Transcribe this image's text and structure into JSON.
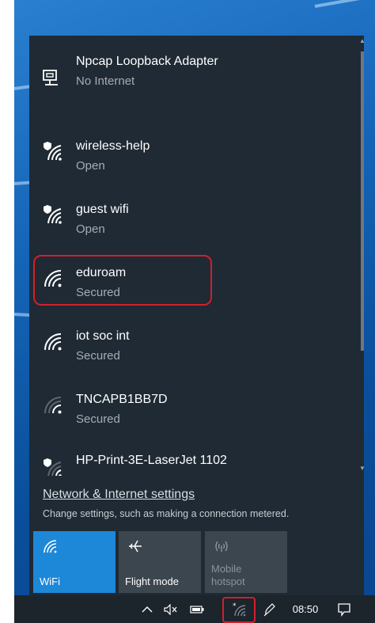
{
  "networks": [
    {
      "name": "Npcap Loopback Adapter",
      "status": "No Internet",
      "icon": "ethernet-icon"
    },
    {
      "name": "wireless-help",
      "status": "Open",
      "icon": "wifi-shield-icon"
    },
    {
      "name": "guest wifi",
      "status": "Open",
      "icon": "wifi-shield-icon"
    },
    {
      "name": "eduroam",
      "status": "Secured",
      "icon": "wifi-icon"
    },
    {
      "name": "iot soc int",
      "status": "Secured",
      "icon": "wifi-icon"
    },
    {
      "name": "TNCAPB1BB7D",
      "status": "Secured",
      "icon": "wifi-icon"
    },
    {
      "name": "HP-Print-3E-LaserJet 1102",
      "status": "",
      "icon": "wifi-shield-icon"
    }
  ],
  "settings": {
    "link": "Network & Internet settings",
    "description": "Change settings, such as making a connection metered."
  },
  "quick_actions": [
    {
      "label": "WiFi",
      "active": true,
      "icon": "wifi-icon"
    },
    {
      "label": "Flight mode",
      "active": false,
      "icon": "airplane-icon"
    },
    {
      "label": "Mobile hotspot",
      "active": false,
      "disabled": true,
      "icon": "hotspot-icon"
    }
  ],
  "taskbar": {
    "time": "08:50",
    "icons": [
      "chevron-up-icon",
      "volume-muted-icon",
      "battery-icon",
      "wifi-tray-icon",
      "pen-icon",
      "action-center-icon"
    ]
  },
  "colors": {
    "panel_bg": "#1f2a34",
    "accent": "#1e88d8",
    "highlight": "#d21f2d"
  }
}
